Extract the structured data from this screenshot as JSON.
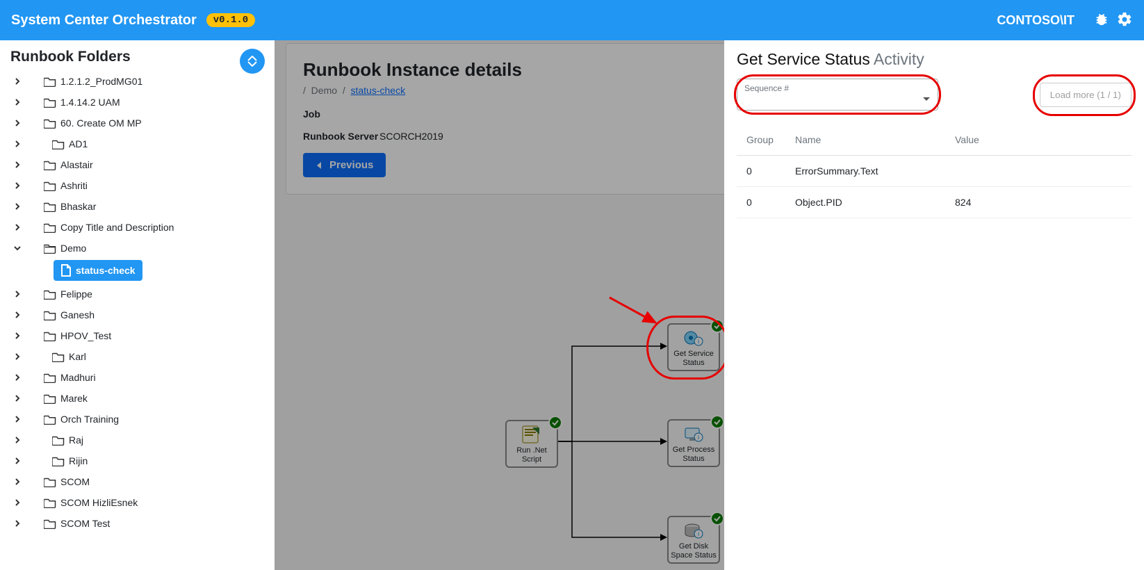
{
  "header": {
    "title": "System Center Orchestrator",
    "version": "v0.1.0",
    "user": "CONTOSO\\IT"
  },
  "sidebar": {
    "title": "Runbook Folders",
    "items": [
      {
        "label": "1.2.1.2_ProdMG01",
        "expanded": false,
        "indent": 1
      },
      {
        "label": "1.4.14.2 UAM",
        "expanded": false,
        "indent": 1
      },
      {
        "label": "60. Create OM MP",
        "expanded": false,
        "indent": 1
      },
      {
        "label": "AD1",
        "expanded": false,
        "indent": 2
      },
      {
        "label": "Alastair",
        "expanded": false,
        "indent": 1
      },
      {
        "label": "Ashriti",
        "expanded": false,
        "indent": 1
      },
      {
        "label": "Bhaskar",
        "expanded": false,
        "indent": 1
      },
      {
        "label": "Copy Title and Description",
        "expanded": false,
        "indent": 1
      },
      {
        "label": "Demo",
        "expanded": true,
        "indent": 1
      },
      {
        "label": "Felippe",
        "expanded": false,
        "indent": 1
      },
      {
        "label": "Ganesh",
        "expanded": false,
        "indent": 1
      },
      {
        "label": "HPOV_Test",
        "expanded": false,
        "indent": 1
      },
      {
        "label": "Karl",
        "expanded": false,
        "indent": 2
      },
      {
        "label": "Madhuri",
        "expanded": false,
        "indent": 1
      },
      {
        "label": "Marek",
        "expanded": false,
        "indent": 1
      },
      {
        "label": "Orch Training",
        "expanded": false,
        "indent": 1
      },
      {
        "label": "Raj",
        "expanded": false,
        "indent": 2
      },
      {
        "label": "Rijin",
        "expanded": false,
        "indent": 2
      },
      {
        "label": "SCOM",
        "expanded": false,
        "indent": 1
      },
      {
        "label": "SCOM HizliEsnek",
        "expanded": false,
        "indent": 1
      },
      {
        "label": "SCOM Test",
        "expanded": false,
        "indent": 1
      }
    ],
    "leaf": "status-check"
  },
  "main": {
    "title": "Runbook Instance details",
    "breadcrumb": {
      "sep": "/",
      "p1": "Demo",
      "p2": "status-check"
    },
    "job_label": "Job",
    "rs_label": "Runbook Server",
    "rs_value": "SCORCH2019",
    "prev": "Previous"
  },
  "activities": {
    "run": "Run .Net Script",
    "svc": "Get Service Status",
    "proc": "Get Process Status",
    "disk": "Get Disk Space Status"
  },
  "panel": {
    "title": "Get Service Status",
    "subtitle": "Activity",
    "seq_label": "Sequence #",
    "loadmore": "Load more (1 / 1)",
    "cols": {
      "g": "Group",
      "n": "Name",
      "v": "Value"
    },
    "rows": [
      {
        "g": "0",
        "n": "ErrorSummary.Text",
        "v": ""
      },
      {
        "g": "0",
        "n": "Object.PID",
        "v": "824"
      }
    ]
  }
}
